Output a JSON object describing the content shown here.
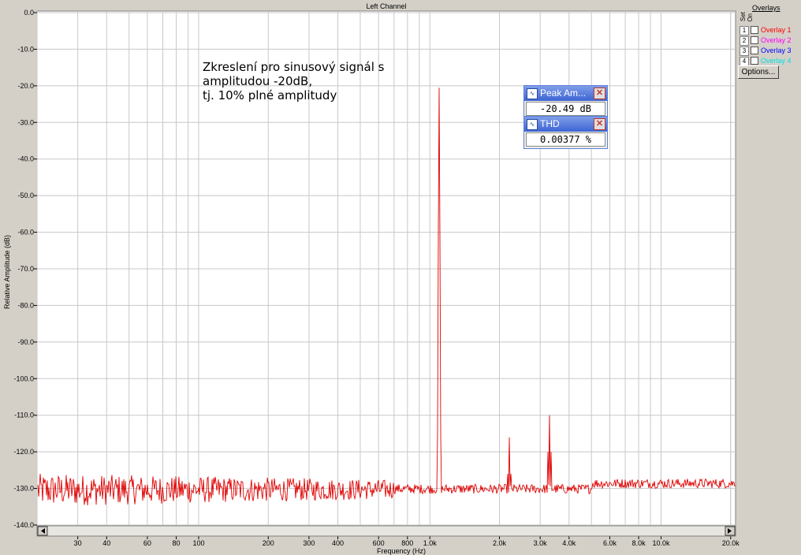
{
  "window": {
    "title": "Left Channel"
  },
  "chart_data": {
    "type": "line",
    "title": "Left Channel",
    "xlabel": "Frequency (Hz)",
    "ylabel": "Relative Amplitude (dB)",
    "xscale": "log",
    "xlim": [
      20,
      21000
    ],
    "ylim": [
      -140,
      0
    ],
    "grid": true,
    "y_ticks": [
      "0.0",
      "-10.0",
      "-20.0",
      "-30.0",
      "-40.0",
      "-50.0",
      "-60.0",
      "-70.0",
      "-80.0",
      "-90.0",
      "-100.0",
      "-110.0",
      "-120.0",
      "-130.0",
      "-140.0"
    ],
    "x_ticks": [
      {
        "v": 30,
        "label": "30"
      },
      {
        "v": 40,
        "label": "40"
      },
      {
        "v": 60,
        "label": "60"
      },
      {
        "v": 80,
        "label": "80"
      },
      {
        "v": 100,
        "label": "100"
      },
      {
        "v": 200,
        "label": "200"
      },
      {
        "v": 300,
        "label": "300"
      },
      {
        "v": 400,
        "label": "400"
      },
      {
        "v": 600,
        "label": "600"
      },
      {
        "v": 800,
        "label": "800"
      },
      {
        "v": 1000,
        "label": "1.0k"
      },
      {
        "v": 2000,
        "label": "2.0k"
      },
      {
        "v": 3000,
        "label": "3.0k"
      },
      {
        "v": 4000,
        "label": "4.0k"
      },
      {
        "v": 6000,
        "label": "6.0k"
      },
      {
        "v": 8000,
        "label": "8.0k"
      },
      {
        "v": 10000,
        "label": "10.0k"
      },
      {
        "v": 20000,
        "label": "20.0k"
      }
    ],
    "series": [
      {
        "color": "#e00000",
        "noise_floor_db": -130,
        "peaks": [
          {
            "x": 1100,
            "y": -20.5
          },
          {
            "x": 2200,
            "y": -116
          },
          {
            "x": 3300,
            "y": -110
          }
        ]
      }
    ]
  },
  "annotation": {
    "lines": [
      "Zkreslení pro sinusový signál s",
      "amplitudou -20dB,",
      "tj. 10% plné amplitudy"
    ]
  },
  "meters": [
    {
      "title": "Peak Am...",
      "value": "-20.49 dB"
    },
    {
      "title": "THD",
      "value": "0.00377 %"
    }
  ],
  "overlays": {
    "title": "Overlays",
    "set_label": "Set",
    "on_label": "On",
    "items": [
      {
        "num": "1",
        "label": "Overlay 1",
        "color": "#ff0000"
      },
      {
        "num": "2",
        "label": "Overlay 2",
        "color": "#ff00ff"
      },
      {
        "num": "3",
        "label": "Overlay 3",
        "color": "#0000ff"
      },
      {
        "num": "4",
        "label": "Overlay 4",
        "color": "#00e0e0"
      }
    ],
    "options_label": "Options..."
  }
}
